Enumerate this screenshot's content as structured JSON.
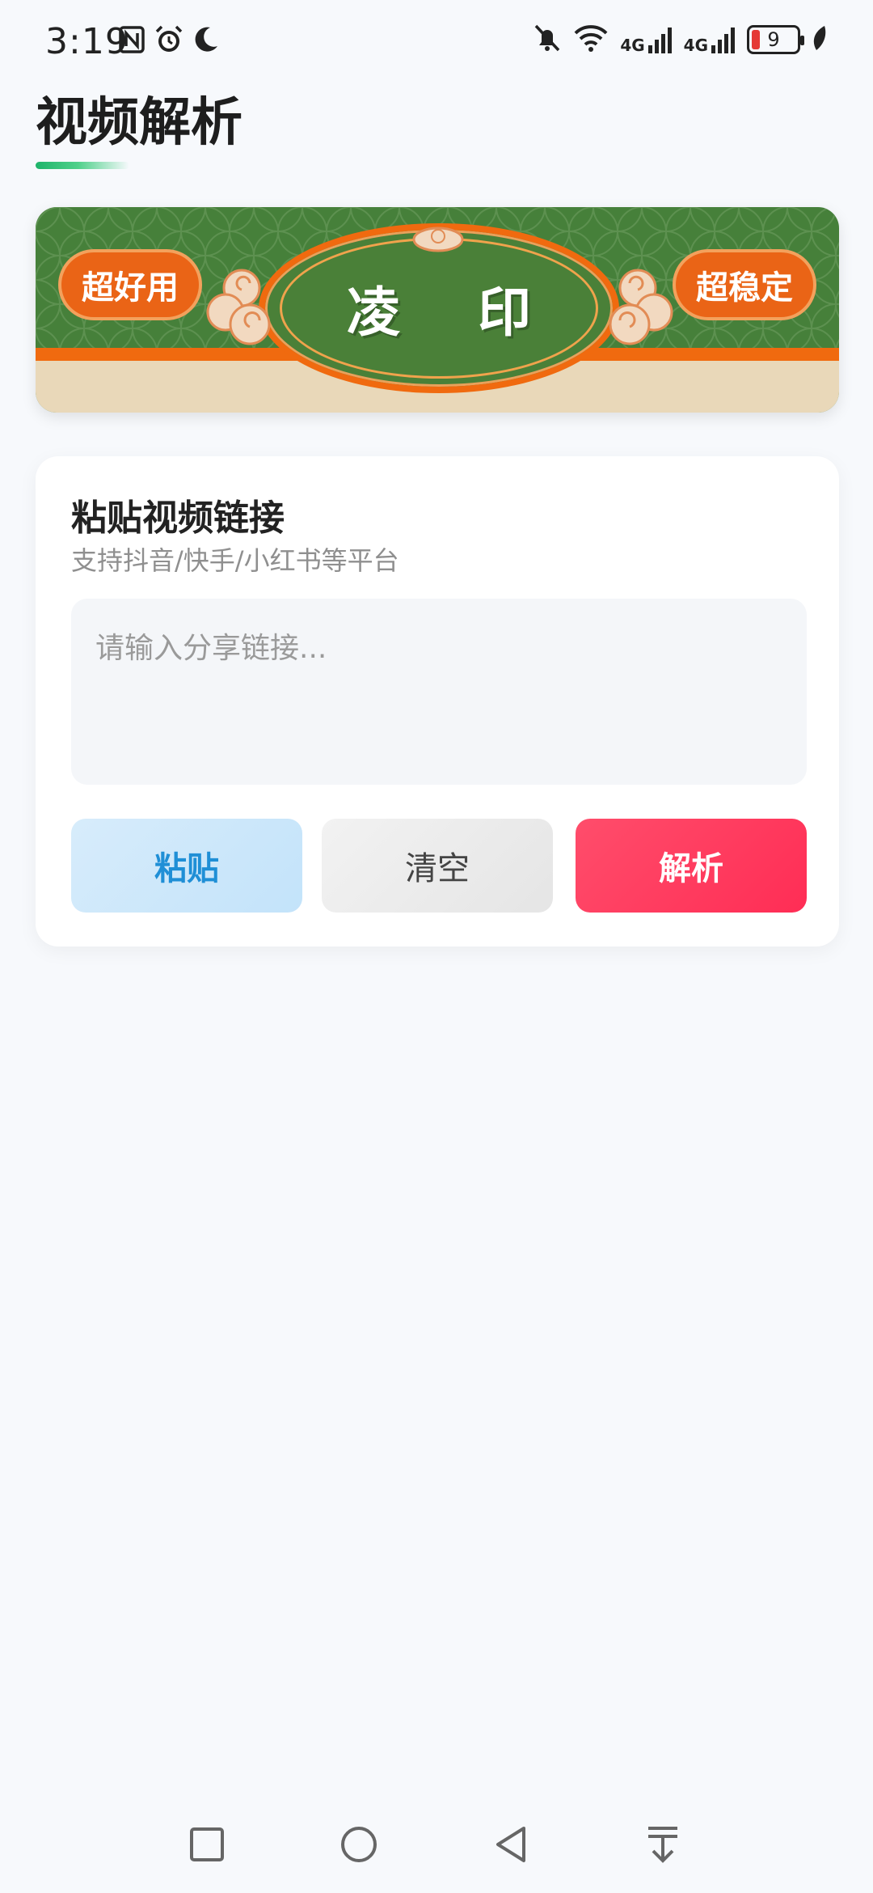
{
  "status_bar": {
    "time": "3:19",
    "left_icons": [
      "nfc-icon",
      "alarm-icon",
      "moon-icon"
    ],
    "right_icons": [
      "mute-bell-icon",
      "wifi-icon",
      "signal-4g-icon",
      "signal-4g-icon",
      "battery-icon",
      "leaf-icon"
    ],
    "network_label_1": "4G",
    "network_label_2": "4G",
    "battery_level": "9"
  },
  "header": {
    "title": "视频解析"
  },
  "banner": {
    "left_badge": "超好用",
    "right_badge": "超稳定",
    "center_char_1": "凌",
    "center_char_2": "印"
  },
  "card": {
    "title": "粘贴视频链接",
    "subtitle": "支持抖音/快手/小红书等平台",
    "input_placeholder": "请输入分享链接...",
    "input_value": "",
    "buttons": {
      "paste": "粘贴",
      "clear": "清空",
      "parse": "解析"
    }
  },
  "nav_bar": {
    "icons": [
      "recent-apps-icon",
      "home-icon",
      "back-icon",
      "expand-notifications-icon"
    ]
  },
  "colors": {
    "accent_red": "#ff2d55",
    "paste_blue": "#1f8fd6",
    "banner_green": "#46803a",
    "banner_orange": "#f06a0f",
    "title_underline_green": "#1fb46b"
  }
}
